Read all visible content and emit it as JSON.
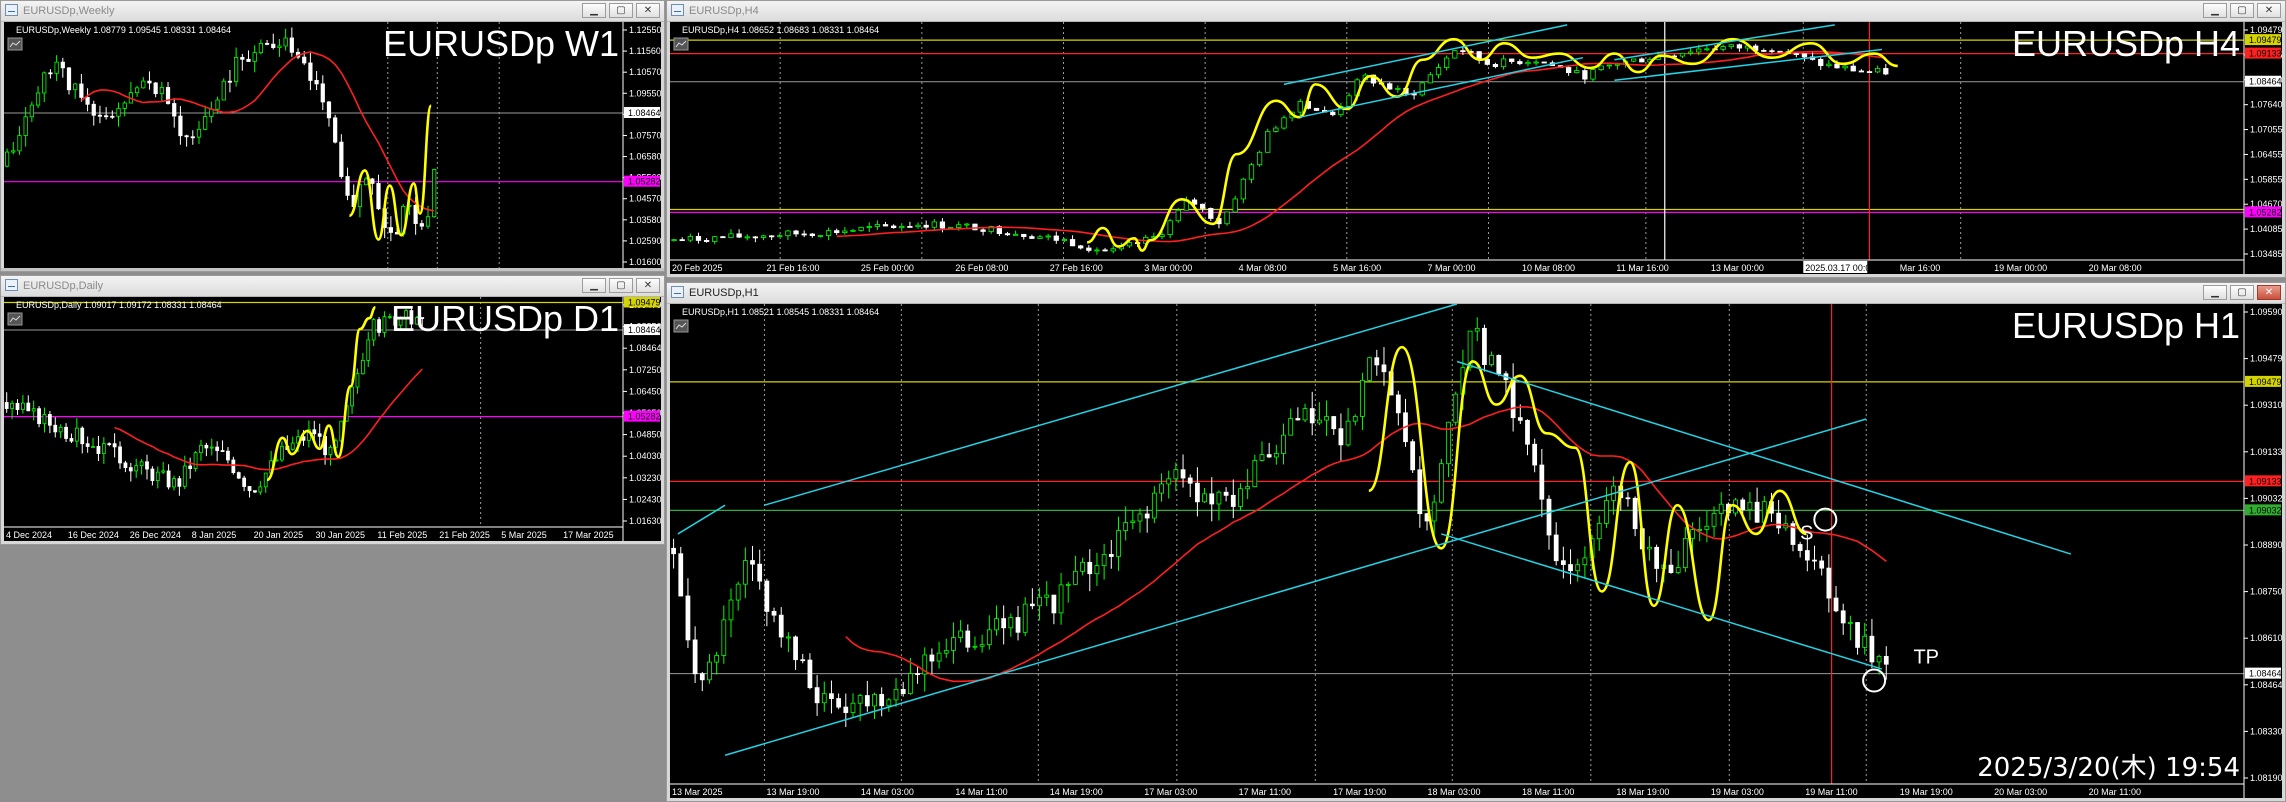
{
  "timestamp": "2025/3/20(木) 19:54",
  "colors": {
    "bg": "#000000",
    "bull": "#00ff00",
    "bear": "#ffffff",
    "ma": "#ff1f1f",
    "zigzag": "#ffff00",
    "channel": "#22d3e6",
    "hline_red": "#ff2020",
    "hline_yellow": "#d4d400",
    "hline_green": "#2fae2f",
    "hline_magenta": "#ff00ff",
    "axis": "#ffffff",
    "grid": "#cfcfcf"
  },
  "icons": {
    "window": "chart-window-icon",
    "minimize": "minimize-icon",
    "maximize": "maximize-icon",
    "close": "close-icon",
    "mini_toolbar": "mini-chart-icon"
  },
  "windows": [
    {
      "id": "w1",
      "title": "EURUSDp,Weekly",
      "info": "EURUSDp,Weekly  1.08779 1.09545 1.08331 1.08464",
      "label": "EURUSDp W1",
      "active": false,
      "axis_min": 1.0128,
      "axis_max": 1.1268,
      "price_ticks": [
        "1.12550",
        "1.11560",
        "1.10570",
        "1.09550",
        "1.08560",
        "1.07570",
        "1.06580",
        "1.05560",
        "1.04570",
        "1.03580",
        "1.02590",
        "1.01600"
      ],
      "time_ticks": [],
      "current_price": "1.08464",
      "hlines": [
        {
          "price": 1.0528,
          "color": "#ff00ff",
          "label": "1.05282"
        }
      ],
      "vlines_frac": [
        0.62,
        0.7,
        0.8
      ],
      "gen": {
        "seed": 11,
        "n": 70,
        "path": [
          [
            0,
            1.06
          ],
          [
            0.08,
            1.11
          ],
          [
            0.15,
            1.08
          ],
          [
            0.24,
            1.1
          ],
          [
            0.3,
            1.07
          ],
          [
            0.38,
            1.11
          ],
          [
            0.45,
            1.12
          ],
          [
            0.52,
            1.09
          ],
          [
            0.56,
            1.04
          ],
          [
            0.59,
            1.06
          ],
          [
            0.62,
            1.025
          ],
          [
            0.65,
            1.04
          ],
          [
            0.68,
            1.03
          ],
          [
            0.71,
            1.09
          ],
          [
            1,
            1.088
          ]
        ],
        "vol": 0.006,
        "ma_period": 12,
        "ma_lag": 0
      },
      "zigzag": [
        [
          0.558,
          1.037
        ],
        [
          0.583,
          1.058
        ],
        [
          0.605,
          1.026
        ],
        [
          0.623,
          1.051
        ],
        [
          0.642,
          1.028
        ],
        [
          0.662,
          1.052
        ],
        [
          0.672,
          1.038
        ],
        [
          0.69,
          1.088
        ]
      ],
      "channels": [],
      "markers": [],
      "candle_end": 0.7
    },
    {
      "id": "h4",
      "title": "EURUSDp,H4",
      "info": "EURUSDp,H4  1.08652 1.08683 1.08331 1.08464",
      "label": "EURUSDp H4",
      "active": false,
      "axis_min": 1.0412,
      "axis_max": 1.0992,
      "price_ticks": [
        "1.09479",
        "1.08825",
        "1.08240",
        "1.07640",
        "1.07055",
        "1.06455",
        "1.05855",
        "1.04670",
        "1.04085",
        "1.03485"
      ],
      "time_ticks": [
        "20 Feb 2025",
        "21 Feb 16:00",
        "25 Feb 00:00",
        "26 Feb 08:00",
        "27 Feb 16:00",
        "3 Mar 00:00",
        "4 Mar 08:00",
        "5 Mar 16:00",
        "7 Mar 00:00",
        "10 Mar 08:00",
        "11 Mar 16:00",
        "13 Mar 00:00",
        "2025.03.17 00:00",
        "Mar 16:00",
        "19 Mar 00:00",
        "20 Mar 08:00"
      ],
      "current_price": "1.08464",
      "hlines": [
        {
          "price": 1.09479,
          "color": "#d4d400",
          "label": "1.09479"
        },
        {
          "price": 1.0915,
          "color": "#ff2020",
          "label": "1.09133"
        },
        {
          "price": 1.0535,
          "color": "#d4d400",
          "label": ""
        },
        {
          "price": 1.0528,
          "color": "#ff00ff",
          "label": "1.05282"
        }
      ],
      "vlines_frac": [
        0.07,
        0.16,
        0.25,
        0.34,
        0.43,
        0.52,
        0.62,
        0.72,
        0.82
      ],
      "vline_white": 0.632,
      "vline_red": 0.762,
      "gen": {
        "seed": 7,
        "n": 150,
        "path": [
          [
            0,
            1.046
          ],
          [
            0.1,
            1.048
          ],
          [
            0.16,
            1.05
          ],
          [
            0.2,
            1.049
          ],
          [
            0.25,
            1.046
          ],
          [
            0.28,
            1.043
          ],
          [
            0.31,
            1.047
          ],
          [
            0.33,
            1.056
          ],
          [
            0.35,
            1.05
          ],
          [
            0.38,
            1.072
          ],
          [
            0.4,
            1.08
          ],
          [
            0.42,
            1.076
          ],
          [
            0.44,
            1.086
          ],
          [
            0.47,
            1.081
          ],
          [
            0.5,
            1.093
          ],
          [
            0.52,
            1.089
          ],
          [
            0.55,
            1.09
          ],
          [
            0.58,
            1.086
          ],
          [
            0.6,
            1.089
          ],
          [
            0.66,
            1.093
          ],
          [
            0.7,
            1.093
          ],
          [
            0.73,
            1.089
          ],
          [
            0.76,
            1.087
          ],
          [
            1,
            1.087
          ]
        ],
        "vol": 0.0013,
        "ma_period": 20,
        "ma_lag": 0
      },
      "zigzag": [
        [
          0.265,
          1.0455
        ],
        [
          0.275,
          1.049
        ],
        [
          0.285,
          1.0445
        ],
        [
          0.295,
          1.0465
        ],
        [
          0.3,
          1.0435
        ],
        [
          0.305,
          1.046
        ],
        [
          0.325,
          1.056
        ],
        [
          0.345,
          1.05
        ],
        [
          0.36,
          1.067
        ],
        [
          0.385,
          1.08
        ],
        [
          0.4,
          1.076
        ],
        [
          0.41,
          1.084
        ],
        [
          0.43,
          1.078
        ],
        [
          0.445,
          1.086
        ],
        [
          0.462,
          1.081
        ],
        [
          0.478,
          1.09
        ],
        [
          0.498,
          1.095
        ],
        [
          0.515,
          1.09
        ],
        [
          0.53,
          1.094
        ],
        [
          0.548,
          1.0905
        ],
        [
          0.565,
          1.0915
        ],
        [
          0.585,
          1.088
        ],
        [
          0.6,
          1.0915
        ],
        [
          0.615,
          1.087
        ],
        [
          0.63,
          1.091
        ],
        [
          0.65,
          1.089
        ],
        [
          0.675,
          1.095
        ],
        [
          0.7,
          1.0905
        ],
        [
          0.725,
          1.094
        ],
        [
          0.745,
          1.089
        ],
        [
          0.765,
          1.0915
        ],
        [
          0.78,
          1.0885
        ]
      ],
      "channels": [
        {
          "x1": 0.39,
          "y1": 1.084,
          "x2": 0.57,
          "y2": 1.0985
        },
        {
          "x1": 0.4,
          "y1": 1.076,
          "x2": 0.58,
          "y2": 1.0905
        },
        {
          "x1": 0.6,
          "y1": 1.09,
          "x2": 0.74,
          "y2": 1.0985
        },
        {
          "x1": 0.6,
          "y1": 1.085,
          "x2": 0.77,
          "y2": 1.0925
        }
      ],
      "markers": [],
      "candle_end": 0.775
    },
    {
      "id": "d1",
      "title": "EURUSDp,Daily",
      "info": "EURUSDp,Daily  1.09017 1.09172 1.08331 1.08464",
      "label": "EURUSDp D1",
      "active": false,
      "axis_min": 1.0122,
      "axis_max": 1.0968,
      "price_ticks": [
        "1.09479",
        "1.08850",
        "1.08464",
        "1.07250",
        "1.06450",
        "1.05650",
        "1.04850",
        "1.04030",
        "1.03230",
        "1.02430",
        "1.01630"
      ],
      "time_ticks": [
        "4 Dec 2024",
        "16 Dec 2024",
        "26 Dec 2024",
        "8 Jan 2025",
        "20 Jan 2025",
        "30 Jan 2025",
        "11 Feb 2025",
        "21 Feb 2025",
        "5 Mar 2025",
        "17 Mar 2025"
      ],
      "current_price": "1.08464",
      "hlines": [
        {
          "price": 1.09479,
          "color": "#d4d400",
          "label": "1.09479"
        },
        {
          "price": 1.0528,
          "color": "#ff00ff",
          "label": "1.05282"
        }
      ],
      "vlines_frac": [
        0.77
      ],
      "gen": {
        "seed": 3,
        "n": 78,
        "path": [
          [
            0,
            1.058
          ],
          [
            0.08,
            1.05
          ],
          [
            0.17,
            1.04
          ],
          [
            0.22,
            1.034
          ],
          [
            0.28,
            1.028
          ],
          [
            0.32,
            1.042
          ],
          [
            0.36,
            1.038
          ],
          [
            0.4,
            1.026
          ],
          [
            0.45,
            1.04
          ],
          [
            0.5,
            1.048
          ],
          [
            0.53,
            1.038
          ],
          [
            0.56,
            1.06
          ],
          [
            0.59,
            1.085
          ],
          [
            0.64,
            1.09
          ],
          [
            0.68,
            1.086
          ],
          [
            1,
            1.086
          ]
        ],
        "vol": 0.0045,
        "ma_period": 20,
        "ma_lag": 0
      },
      "zigzag": [
        [
          0.425,
          1.0295
        ],
        [
          0.45,
          1.045
        ],
        [
          0.465,
          1.039
        ],
        [
          0.49,
          1.0475
        ],
        [
          0.51,
          1.041
        ],
        [
          0.525,
          1.0495
        ],
        [
          0.54,
          1.038
        ],
        [
          0.56,
          1.064
        ],
        [
          0.575,
          1.085
        ],
        [
          0.59,
          1.089
        ],
        [
          0.6,
          1.093
        ]
      ],
      "channels": [],
      "markers": [],
      "candle_end": 0.68
    },
    {
      "id": "h1",
      "title": "EURUSDp,H1",
      "info": "EURUSDp,H1  1.08521 1.08545 1.08331 1.08464",
      "label": "EURUSDp H1",
      "active": true,
      "axis_min": 1.0808,
      "axis_max": 1.0975,
      "price_ticks": [
        "1.09590",
        "1.09479",
        "1.09310",
        "1.09133",
        "1.09032",
        "1.08890",
        "1.08750",
        "1.08610",
        "1.08464",
        "1.08330",
        "1.08190"
      ],
      "time_ticks": [
        "13 Mar 2025",
        "13 Mar 19:00",
        "14 Mar 03:00",
        "14 Mar 11:00",
        "14 Mar 19:00",
        "17 Mar 03:00",
        "17 Mar 11:00",
        "17 Mar 19:00",
        "18 Mar 03:00",
        "18 Mar 11:00",
        "18 Mar 19:00",
        "19 Mar 03:00",
        "19 Mar 11:00",
        "19 Mar 19:00",
        "20 Mar 03:00",
        "20 Mar 11:00"
      ],
      "current_price": "1.08464",
      "hlines": [
        {
          "price": 1.09479,
          "color": "#d4d400",
          "label": "1.09479"
        },
        {
          "price": 1.09133,
          "color": "#ff2020",
          "label": "1.09133"
        },
        {
          "price": 1.09032,
          "color": "#2fae2f",
          "label": "1.09032"
        }
      ],
      "vlines_frac": [
        0.06,
        0.147,
        0.234,
        0.322,
        0.41,
        0.497,
        0.585,
        0.673,
        0.76
      ],
      "vline_red": 0.738,
      "gen": {
        "seed": 5,
        "n": 170,
        "path": [
          [
            0,
            1.089
          ],
          [
            0.02,
            1.084
          ],
          [
            0.05,
            1.0885
          ],
          [
            0.08,
            1.085
          ],
          [
            0.1,
            1.0835
          ],
          [
            0.14,
            1.084
          ],
          [
            0.17,
            1.0855
          ],
          [
            0.2,
            1.086
          ],
          [
            0.24,
            1.087
          ],
          [
            0.28,
            1.089
          ],
          [
            0.32,
            1.0915
          ],
          [
            0.35,
            1.0905
          ],
          [
            0.38,
            1.092
          ],
          [
            0.4,
            1.0935
          ],
          [
            0.43,
            1.093
          ],
          [
            0.45,
            1.096
          ],
          [
            0.48,
            1.0895
          ],
          [
            0.51,
            1.0965
          ],
          [
            0.54,
            1.0935
          ],
          [
            0.57,
            1.0875
          ],
          [
            0.6,
            1.0915
          ],
          [
            0.63,
            1.088
          ],
          [
            0.66,
            1.09
          ],
          [
            0.7,
            1.0905
          ],
          [
            0.72,
            1.089
          ],
          [
            0.75,
            1.086
          ],
          [
            0.78,
            1.0846
          ],
          [
            1,
            1.0846
          ]
        ],
        "vol": 0.0007,
        "ma_period": 24,
        "ma_lag": 0
      },
      "zigzag": [
        [
          0.444,
          1.091
        ],
        [
          0.465,
          1.096
        ],
        [
          0.49,
          1.089
        ],
        [
          0.51,
          1.0955
        ],
        [
          0.525,
          1.094
        ],
        [
          0.54,
          1.095
        ],
        [
          0.557,
          1.093
        ],
        [
          0.575,
          1.0925
        ],
        [
          0.592,
          1.0875
        ],
        [
          0.61,
          1.092
        ],
        [
          0.625,
          1.087
        ],
        [
          0.64,
          1.0905
        ],
        [
          0.66,
          1.0865
        ],
        [
          0.675,
          1.0905
        ],
        [
          0.69,
          1.0895
        ],
        [
          0.705,
          1.091
        ],
        [
          0.722,
          1.0895
        ]
      ],
      "channels": [
        {
          "x1": 0.005,
          "y1": 1.0895,
          "x2": 0.035,
          "y2": 1.0905
        },
        {
          "x1": 0.06,
          "y1": 1.0905,
          "x2": 0.5,
          "y2": 1.0975
        },
        {
          "x1": 0.035,
          "y1": 1.0818,
          "x2": 0.76,
          "y2": 1.0935
        },
        {
          "x1": 0.5,
          "y1": 1.0955,
          "x2": 0.89,
          "y2": 1.0888
        },
        {
          "x1": 0.49,
          "y1": 1.0895,
          "x2": 0.77,
          "y2": 1.0848
        }
      ],
      "markers": [
        {
          "type": "circle",
          "x": 0.734,
          "y": 1.09,
          "label": "S",
          "lx": 0.718,
          "ly": 1.0893
        },
        {
          "type": "circle",
          "x": 0.765,
          "y": 1.0844,
          "label": "TP",
          "lx": 0.79,
          "ly": 1.085
        }
      ],
      "candle_end": 0.775
    }
  ]
}
